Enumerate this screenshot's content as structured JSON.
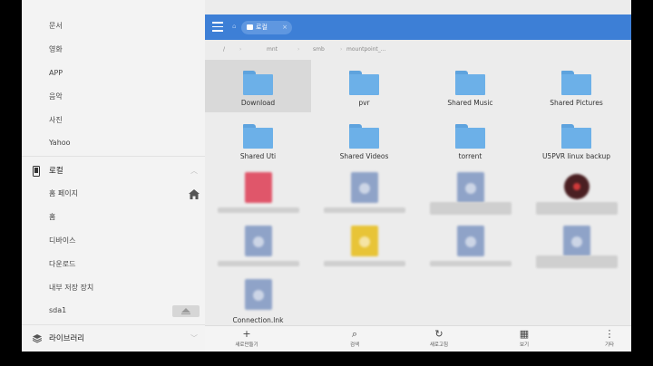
{
  "sidebar": {
    "items_top": [
      {
        "label": "문서"
      },
      {
        "label": "영화"
      },
      {
        "label": "APP"
      },
      {
        "label": "음악"
      },
      {
        "label": "사진"
      },
      {
        "label": "Yahoo"
      }
    ],
    "local_section": {
      "label": "로컬",
      "icon": "phone-icon"
    },
    "local_items": [
      {
        "label": "홈 페이지"
      },
      {
        "label": "홈"
      },
      {
        "label": "디바이스"
      },
      {
        "label": "다운로드"
      },
      {
        "label": "내부 저장 장치"
      },
      {
        "label": "sda1"
      }
    ],
    "library_section": {
      "label": "라이브러리",
      "icon": "library-icon"
    }
  },
  "topbar": {
    "chip_label": "로컬",
    "chip_close": "×",
    "accent": "#3d7fd6"
  },
  "breadcrumb": [
    "/",
    "mnt",
    "smb",
    "mountpoint_..."
  ],
  "grid": {
    "folders": [
      {
        "label": "Download"
      },
      {
        "label": "pvr"
      },
      {
        "label": "Shared Music"
      },
      {
        "label": "Shared Pictures"
      },
      {
        "label": "Shared Uti"
      },
      {
        "label": "Shared Videos"
      },
      {
        "label": "torrent"
      },
      {
        "label": "U5PVR linux backup"
      }
    ],
    "files": [
      {
        "label": "Connection.lnk",
        "color": "#8fa3c8"
      }
    ]
  },
  "bottombar": [
    {
      "label": "새로만들기",
      "icon": "+"
    },
    {
      "label": "검색",
      "icon": "⌕"
    },
    {
      "label": "새로고침",
      "icon": "↻"
    },
    {
      "label": "보기",
      "icon": "▦"
    },
    {
      "label": "기타",
      "icon": "⋮"
    }
  ]
}
